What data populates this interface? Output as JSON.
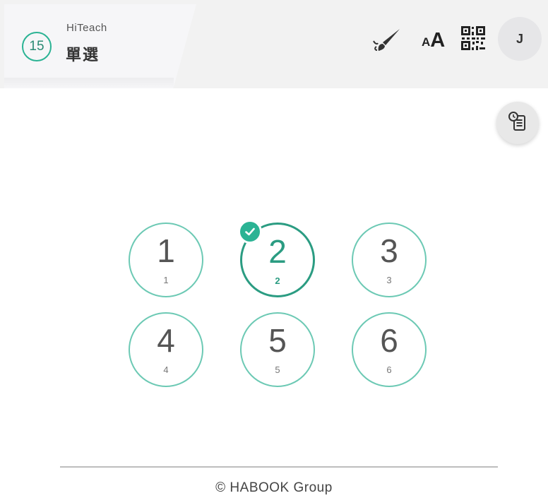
{
  "header": {
    "count": "15",
    "app_name": "HiTeach",
    "mode": "單選",
    "avatar_initial": "J",
    "font_small": "A",
    "font_big": "A"
  },
  "icons": {
    "brush": "brush-icon",
    "font_size": "font-size-icon",
    "qr": "qr-code-icon",
    "history": "history-clipboard-icon",
    "check": "check-icon"
  },
  "options": [
    {
      "label": "1",
      "sub": "1",
      "selected": false
    },
    {
      "label": "2",
      "sub": "2",
      "selected": true
    },
    {
      "label": "3",
      "sub": "3",
      "selected": false
    },
    {
      "label": "4",
      "sub": "4",
      "selected": false
    },
    {
      "label": "5",
      "sub": "5",
      "selected": false
    },
    {
      "label": "6",
      "sub": "6",
      "selected": false
    }
  ],
  "footer": {
    "copyright": "© HABOOK Group"
  },
  "colors": {
    "accent": "#2bb394",
    "option_border": "#6cc9b4",
    "header_bg": "#f2f2f2"
  }
}
